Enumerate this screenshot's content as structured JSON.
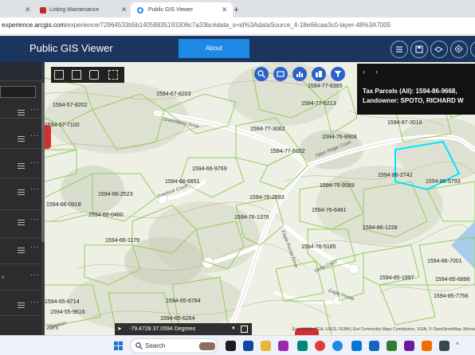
{
  "browser": {
    "tabs": [
      {
        "title": "Listing Maintenance",
        "active": false
      },
      {
        "title": "Public GIS Viewer",
        "active": true
      }
    ],
    "address": {
      "host": "experience.arcgis.com",
      "path": "/experience/72964533b5b14058835193306c7a33bc#data_s=id%3AdataSource_4-18e66caa3c0-layer-48%3A7005"
    }
  },
  "app": {
    "title": "Public GIS Viewer",
    "about_label": "About",
    "header_icons": [
      "list-icon",
      "save-icon",
      "layers-swap-icon",
      "locate-icon",
      "print-icon"
    ]
  },
  "map": {
    "popup": {
      "text": "Tax Parcels (All): 1594-86-9668, Landowner: SPOTO, RICHARD W"
    },
    "parcels": [
      "1594-67-8203",
      "1594-57-8202",
      "1594-57-7100",
      "1594-77-6395",
      "1594-77-6213",
      "1594-77-3062",
      "1594-76-8908",
      "1594-87-3016",
      "1594-77-6102",
      "1594-66-9769",
      "1594-86-2742",
      "1594-86-5793",
      "1594-66-6651",
      "1594-76-9569",
      "1594-66-2523",
      "1594-76-2593",
      "1594-66-0918",
      "1594-76-6481",
      "1594-66-0480",
      "1594-76-1376",
      "1594-86-1228",
      "1594-66-1179",
      "1594-76-5185",
      "1594-86-7001",
      "1594-85-1997",
      "1594-85-6896",
      "1594-85-7756",
      "1594-65-8714",
      "1594-55-9616",
      "1594-65-6784",
      "1594-65-6264"
    ],
    "roads": [
      "Greenberry Drive",
      "Talon Ridge Court",
      "Overlook Court",
      "Eagle Pointe Drive",
      "Delta Court",
      "Eagle Pointe",
      "Garrison"
    ],
    "coord_text": "-79.4728 37.0594 Degrees",
    "scale_text": "200 ft",
    "attribution": "Esri, NASA, NGA, USGS, FEMA | Esri Community Maps Contributors, VGIN, © OpenStreetMap, Micros"
  },
  "taskbar": {
    "search_label": "Search"
  }
}
